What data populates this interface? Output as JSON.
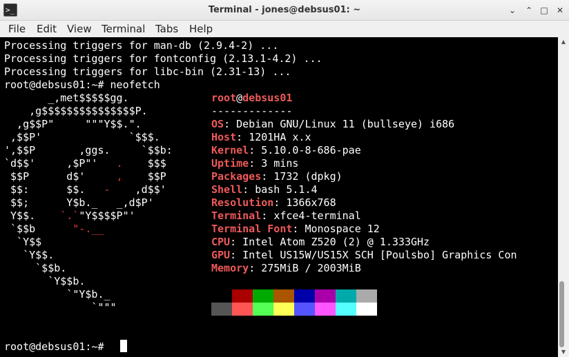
{
  "window": {
    "title": "Terminal - jones@debsus01: ~",
    "app_icon_glyph": ">_",
    "buttons": {
      "minimize": "⌄",
      "maximize": "⌃",
      "restore": "□",
      "close": "✕"
    }
  },
  "menu": [
    "File",
    "Edit",
    "View",
    "Terminal",
    "Tabs",
    "Help"
  ],
  "terminal": {
    "lines_before": [
      "Processing triggers for man-db (2.9.4-2) ...",
      "Processing triggers for fontconfig (2.13.1-4.2) ...",
      "Processing triggers for libc-bin (2.31-13) ...",
      "root@debsus01:~# neofetch"
    ],
    "logo": [
      "       _,met$$$$$gg.",
      "    ,g$$$$$$$$$$$$$$$P.",
      "  ,g$$P\"     \"\"\"Y$$.\".",
      " ,$$P'              `$$$.",
      "',$$P       ,ggs.     `$$b:",
      "`d$$'     ,$P\"'   .    $$$",
      " $$P      d$'     ,    $$P",
      " $$:      $$.   -    ,d$$'",
      " $$;      Y$b._   _,d$P'",
      " Y$$.    `.`\"Y$$$$P\"'",
      " `$$b      \"-.__",
      "  `Y$$",
      "   `Y$$.",
      "     `$$b.",
      "       `Y$$b.",
      "          `\"Y$b._",
      "              `\"\"\""
    ],
    "info": {
      "user": "root",
      "at": "@",
      "host": "debsus01",
      "separator": "-------------",
      "fields": [
        {
          "key": "OS",
          "value": "Debian GNU/Linux 11 (bullseye) i686"
        },
        {
          "key": "Host",
          "value": "1201HA x.x"
        },
        {
          "key": "Kernel",
          "value": "5.10.0-8-686-pae"
        },
        {
          "key": "Uptime",
          "value": "3 mins"
        },
        {
          "key": "Packages",
          "value": "1732 (dpkg)"
        },
        {
          "key": "Shell",
          "value": "bash 5.1.4"
        },
        {
          "key": "Resolution",
          "value": "1366x768"
        },
        {
          "key": "Terminal",
          "value": "xfce4-terminal"
        },
        {
          "key": "Terminal Font",
          "value": "Monospace 12"
        },
        {
          "key": "CPU",
          "value": "Intel Atom Z520 (2) @ 1.333GHz"
        },
        {
          "key": "GPU",
          "value": "Intel US15W/US15X SCH [Poulsbo] Graphics Con"
        },
        {
          "key": "Memory",
          "value": "275MiB / 2003MiB"
        }
      ]
    },
    "palette_normal": [
      "#000000",
      "#aa0000",
      "#00aa00",
      "#aa5500",
      "#0000aa",
      "#aa00aa",
      "#00aaaa",
      "#aaaaaa"
    ],
    "palette_bright": [
      "#555555",
      "#ff5555",
      "#55ff55",
      "#ffff55",
      "#5555ff",
      "#ff55ff",
      "#55ffff",
      "#ffffff"
    ],
    "prompt": "root@debsus01:~# "
  }
}
